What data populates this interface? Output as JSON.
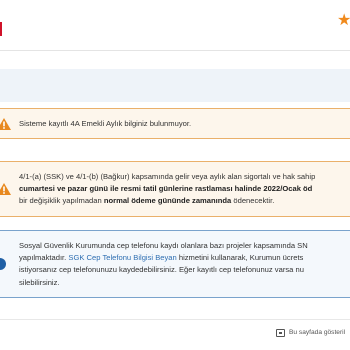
{
  "header": {
    "star_icon": "star-icon"
  },
  "alerts": {
    "alert1": {
      "icon": "warning-icon",
      "text": "Sisteme kayıtlı 4A Emekli Aylık bilginiz bulunmuyor."
    },
    "alert2": {
      "icon": "warning-icon",
      "line1": "4/1-(a) (SSK) ve 4/1-(b) (Bağkur) kapsamında gelir veya aylık alan sigortalı ve hak sahip",
      "line2_bold": "cumartesi ve pazar günü ile resmi tatil günlerine rastlaması halinde 2022/Ocak öd",
      "line3_pre": "bir değişiklik yapılmadan ",
      "line3_bold": "normal ödeme gününde zamanında",
      "line3_post": " ödenecektir."
    },
    "alert3": {
      "icon": "info-icon",
      "line1": "Sosyal Güvenlik Kurumunda cep telefonu kaydı olanlara bazı projeler kapsamında SN",
      "line2_pre": "yapılmaktadır. ",
      "line2_link": "SGK Cep Telefonu Bilgisi Beyan",
      "line2_post": " hizmetini kullanarak, Kurumun ücrets",
      "line3": "istiyorsanız cep telefonunuzu kaydedebilirsiniz. Eğer kayıtlı cep telefonunuz varsa nu",
      "line4": "silebilirsiniz."
    }
  },
  "footer": {
    "icon": "page-icon",
    "text": "Bu sayfada gösteril"
  },
  "colors": {
    "brand_red": "#d0122a",
    "star_orange": "#f08a1d",
    "warning_orange": "#e8891f",
    "info_blue": "#1f5fa5",
    "link_blue": "#2f6fb2"
  }
}
